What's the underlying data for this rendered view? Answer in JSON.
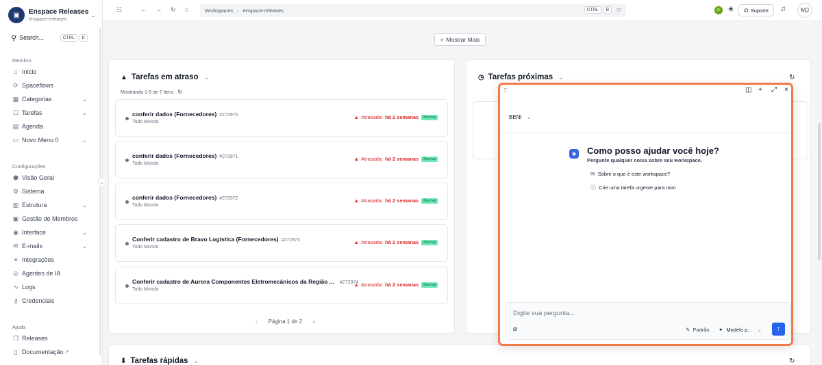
{
  "workspace": {
    "name": "Enspace Releases",
    "slug": "enspace-releases",
    "avatar": "▣"
  },
  "search": {
    "label": "Search...",
    "kbd1": "CTRL",
    "kbd2": "K"
  },
  "sidebar": {
    "membro_label": "Membro",
    "membro_items": [
      {
        "label": "Início",
        "icon": "⌂"
      },
      {
        "label": "Spaceflows",
        "icon": "⟳"
      },
      {
        "label": "Categorias",
        "icon": "▦"
      },
      {
        "label": "Tarefas",
        "icon": "☐"
      },
      {
        "label": "Agenda",
        "icon": "▤"
      },
      {
        "label": "Novo Menu 0",
        "icon": "▭"
      }
    ],
    "config_label": "Configurações",
    "config_items": [
      {
        "label": "Visão Geral",
        "icon": "⬢"
      },
      {
        "label": "Sistema",
        "icon": "⚙"
      },
      {
        "label": "Estrutura",
        "icon": "▥"
      },
      {
        "label": "Gestão de Membros",
        "icon": "▣"
      },
      {
        "label": "Interface",
        "icon": "◉"
      },
      {
        "label": "E-mails",
        "icon": "✉"
      },
      {
        "label": "Integrações",
        "icon": "⚭"
      },
      {
        "label": "Agentes de IA",
        "icon": "◎"
      },
      {
        "label": "Logs",
        "icon": "∿"
      },
      {
        "label": "Credenciais",
        "icon": "⚷"
      }
    ],
    "ajuda_label": "Ajuda",
    "ajuda_items": [
      {
        "label": "Releases",
        "icon": "❐"
      },
      {
        "label": "Documentação",
        "icon": "▯",
        "ext": "↗"
      }
    ]
  },
  "topbar": {
    "breadcrumb_1": "Workspaces",
    "breadcrumb_2": "enspace-releases",
    "kbd1": "CTRL",
    "kbd2": "B",
    "support_label": "Suporte",
    "user_initials": "MJ"
  },
  "main": {
    "show_more": "Mostrar Mais",
    "overdue_title": "Tarefas em atraso",
    "showing": "Mostrando 1-5 de 7 itens",
    "upcoming_title": "Tarefas próximas",
    "quick_title": "Tarefas rápidas",
    "tasks": [
      {
        "title": "conferir dados (Fornecedores)",
        "id": "#272970",
        "assignee": "Todo Mundo",
        "status_prefix": "Atrasada:",
        "status_time": "há 2 semanas",
        "badge": "Normal"
      },
      {
        "title": "conferir dados (Fornecedores)",
        "id": "#272971",
        "assignee": "Todo Mundo",
        "status_prefix": "Atrasada:",
        "status_time": "há 2 semanas",
        "badge": "Normal"
      },
      {
        "title": "conferir dados (Fornecedores)",
        "id": "#272972",
        "assignee": "Todo Mundo",
        "status_prefix": "Atrasada:",
        "status_time": "há 2 semanas",
        "badge": "Normal"
      },
      {
        "title": "Conferir cadastro de Bravo Logística (Fornecedores)",
        "id": "#272973",
        "assignee": "Todo Mundo",
        "status_prefix": "Atrasada:",
        "status_time": "há 2 semanas",
        "badge": "Normal"
      },
      {
        "title": "Conferir cadastro de Aurora Componentes Eletromecânicos da Região ...",
        "id": "#272974",
        "assignee": "Todo Mundo",
        "status_prefix": "Atrasada:",
        "status_time": "há 2 semanas",
        "badge": "Normal"
      }
    ],
    "pager": "Página 1 de 2"
  },
  "ai_panel": {
    "agent": "BENI",
    "heading": "Como posso ajudar você hoje?",
    "subheading": "Pergunte qualquer coisa sobre seu workspace.",
    "suggestion_1": "Sobre o que é este workspace?",
    "suggestion_2": "Crie uma tarefa urgente para mim",
    "input_placeholder": "Digite sua pergunta...",
    "mode": "Padrão",
    "model": "Modelo p..."
  },
  "colors": {
    "accent": "#2563eb",
    "panel_border": "#f07a48",
    "overdue": "#dc2626",
    "badge": "#6ee7b7"
  }
}
